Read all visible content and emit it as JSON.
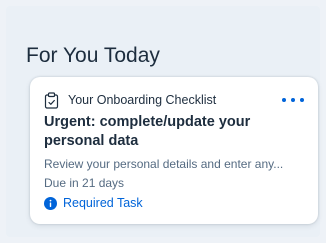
{
  "section": {
    "title": "For You Today"
  },
  "card": {
    "category_icon": "clipboard-icon",
    "category": "Your Onboarding Checklist",
    "more_icon": "more-icon",
    "title": "Urgent: complete/update your personal data",
    "description": "Review your personal details and enter any...",
    "due": "Due in 21 days",
    "status_icon": "info-icon",
    "status": "Required Task"
  },
  "colors": {
    "background": "#eaf0f6",
    "card": "#ffffff",
    "text": "#1d2d3e",
    "secondary_text": "#556b82",
    "accent": "#0064d9"
  }
}
